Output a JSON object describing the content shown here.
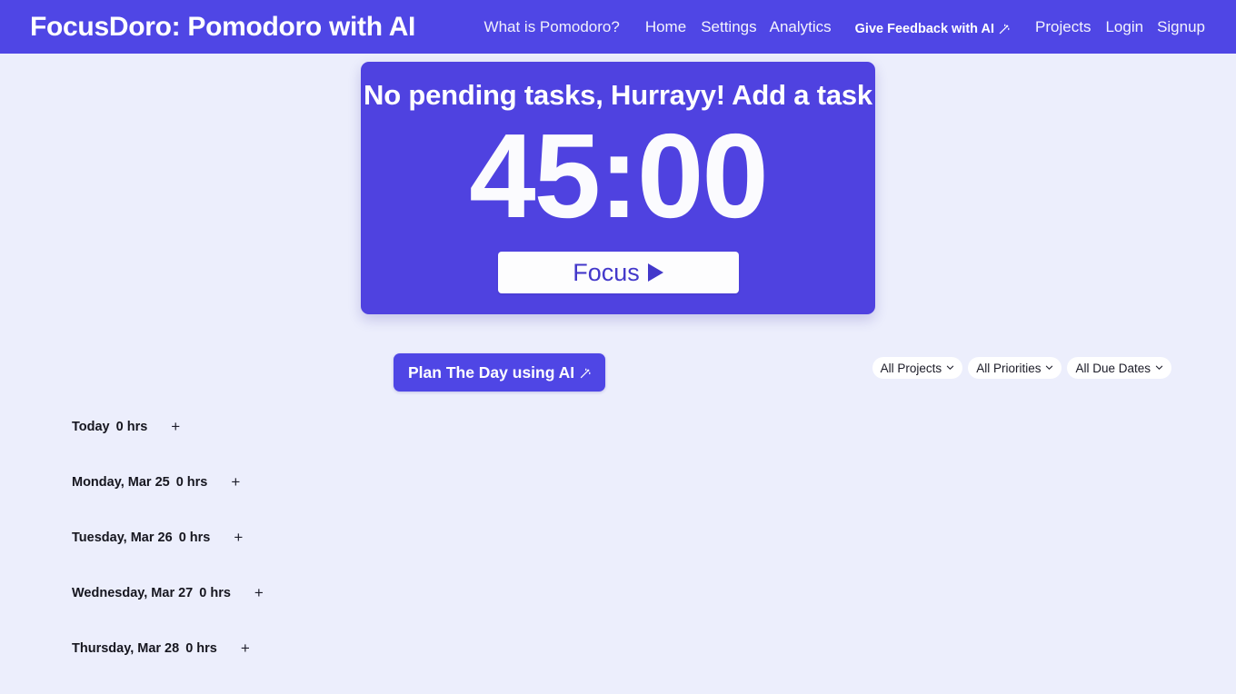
{
  "navbar": {
    "brand": "FocusDoro: Pomodoro with AI",
    "what_is_pomodoro": "What is Pomodoro?",
    "home": "Home",
    "settings": "Settings",
    "analytics": "Analytics",
    "feedback": "Give Feedback with AI",
    "feedback_icon": "magic-wand-icon",
    "projects": "Projects",
    "login": "Login",
    "signup": "Signup",
    "background_color": "#4f46e5"
  },
  "timer": {
    "headline": "No pending tasks, Hurrayy! Add a task",
    "display": "45:00",
    "focus_label": "Focus",
    "focus_icon": "play-icon",
    "card_color": "#4f42e0"
  },
  "plan": {
    "label": "Plan The Day using AI",
    "icon": "magic-wand-icon",
    "color": "#4f46e5"
  },
  "filters": [
    {
      "label": "All Projects",
      "icon": "chevron-down-icon"
    },
    {
      "label": "All Priorities",
      "icon": "chevron-down-icon"
    },
    {
      "label": "All Due Dates",
      "icon": "chevron-down-icon"
    }
  ],
  "days": [
    {
      "label": "Today",
      "hours": "0 hrs",
      "add": "+"
    },
    {
      "label": "Monday, Mar 25",
      "hours": "0 hrs",
      "add": "+"
    },
    {
      "label": "Tuesday, Mar 26",
      "hours": "0 hrs",
      "add": "+"
    },
    {
      "label": "Wednesday, Mar 27",
      "hours": "0 hrs",
      "add": "+"
    },
    {
      "label": "Thursday, Mar 28",
      "hours": "0 hrs",
      "add": "+"
    }
  ],
  "page": {
    "background_color": "#eceefc"
  }
}
